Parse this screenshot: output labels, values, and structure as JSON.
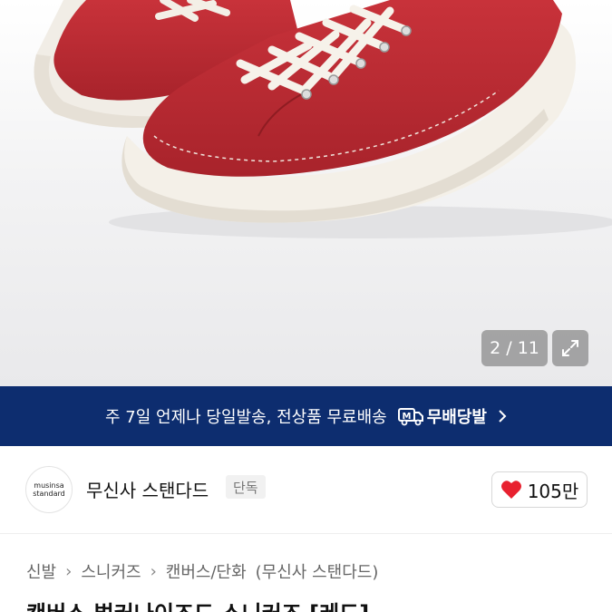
{
  "gallery": {
    "counter": "2 / 11",
    "expand_icon": "expand-icon"
  },
  "delivery_banner": {
    "text": "주 7일 언제나 당일발송, 전상품 무료배송",
    "badge_label": "무배당발",
    "badge_icon": "delivery-truck-icon",
    "color": "#0d2d6f"
  },
  "brand": {
    "logo_line1": "musinsa",
    "logo_line2": "standard",
    "name": "무신사 스탠다드",
    "tag": "단독"
  },
  "likes": {
    "count": "105만",
    "icon": "heart-icon",
    "color": "#e8212f"
  },
  "breadcrumb": {
    "items": [
      "신발",
      "스니커즈",
      "캔버스/단화",
      "(무신사 스탠다드)"
    ]
  },
  "product": {
    "title": "캔버스 벌커나이즈드 스니커즈 [레드]"
  }
}
